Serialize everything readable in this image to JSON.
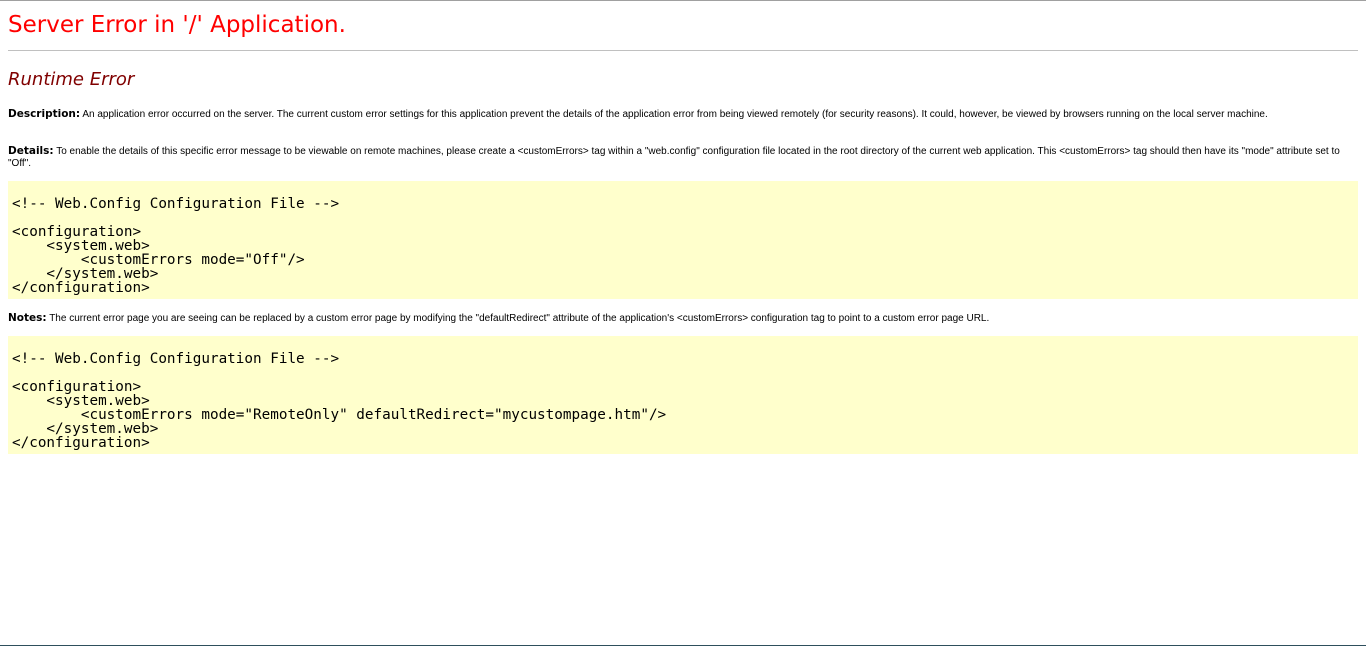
{
  "page": {
    "title": "Server Error in '/' Application.",
    "subtitle": "Runtime Error",
    "colors": {
      "title": "#ff0000",
      "subtitle": "#800000",
      "code_background": "#ffffcc",
      "rule": "#c0c0c0"
    }
  },
  "description": {
    "label": "Description:",
    "text": "An application error occurred on the server. The current custom error settings for this application prevent the details of the application error from being viewed remotely (for security reasons). It could, however, be viewed by browsers running on the local server machine."
  },
  "details": {
    "label": "Details:",
    "text": "To enable the details of this specific error message to be viewable on remote machines, please create a <customErrors> tag within a \"web.config\" configuration file located in the root directory of the current web application. This <customErrors> tag should then have its \"mode\" attribute set to \"Off\"."
  },
  "code1": {
    "lines": [
      "<!-- Web.Config Configuration File -->",
      "",
      "<configuration>",
      "    <system.web>",
      "        <customErrors mode=\"Off\"/>",
      "    </system.web>",
      "</configuration>"
    ]
  },
  "notes": {
    "label": "Notes:",
    "text": "The current error page you are seeing can be replaced by a custom error page by modifying the \"defaultRedirect\" attribute of the application's <customErrors> configuration tag to point to a custom error page URL."
  },
  "code2": {
    "lines": [
      "<!-- Web.Config Configuration File -->",
      "",
      "<configuration>",
      "    <system.web>",
      "        <customErrors mode=\"RemoteOnly\" defaultRedirect=\"mycustompage.htm\"/>",
      "    </system.web>",
      "</configuration>"
    ]
  }
}
